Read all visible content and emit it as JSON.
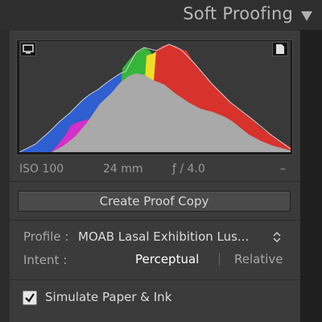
{
  "panel": {
    "title": "Soft Proofing"
  },
  "histogram": {
    "iso": "ISO 100",
    "focal_length": "24 mm",
    "aperture": "ƒ / 4.0",
    "exposure": "–"
  },
  "buttons": {
    "create_proof_copy": "Create Proof Copy"
  },
  "profile": {
    "label": "Profile :",
    "value": "MOAB Lasal Exhibition Lus..."
  },
  "intent": {
    "label": "Intent :",
    "options": [
      "Perceptual",
      "Relative"
    ],
    "selected": "Perceptual"
  },
  "simulate": {
    "label": "Simulate Paper & Ink",
    "checked": true
  },
  "colors": {
    "background": "#2c2c2c",
    "panel": "#3b3b3b",
    "histogram_bg": "#1a1a1a",
    "button": "#4a4a4a"
  }
}
